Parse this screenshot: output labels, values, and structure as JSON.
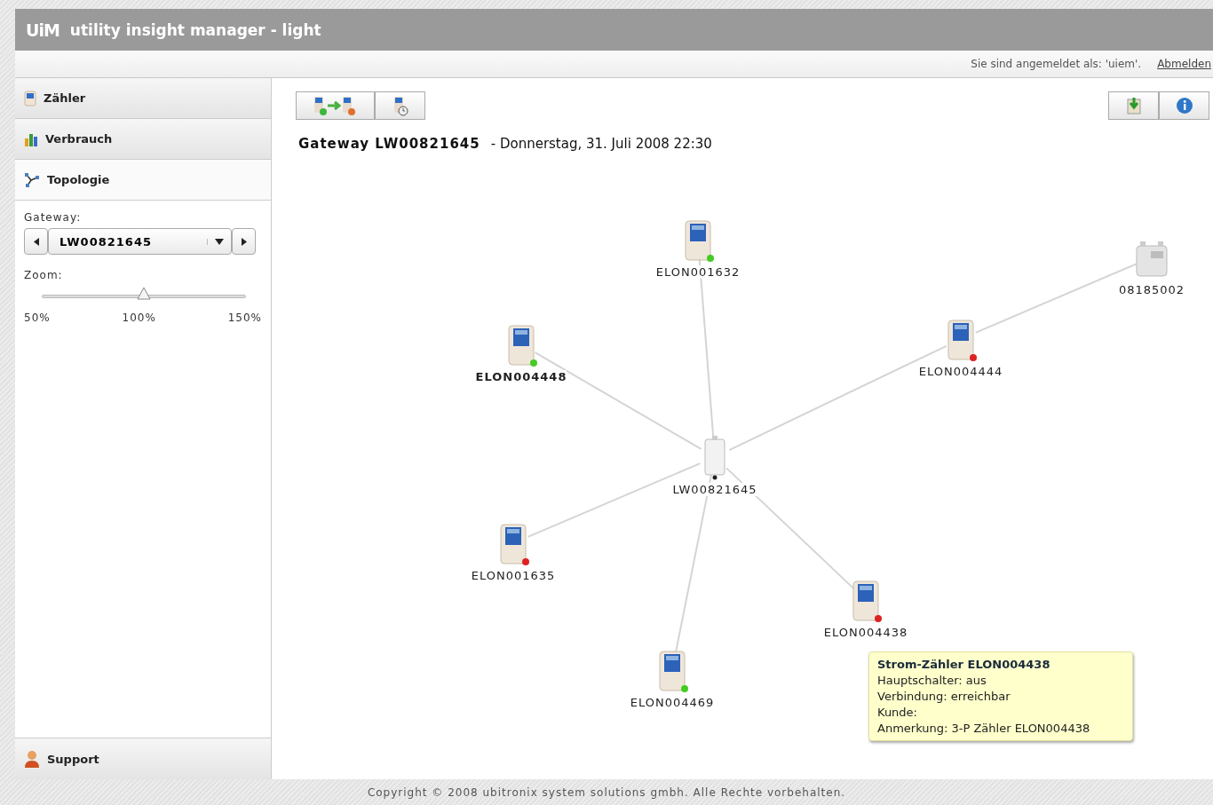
{
  "app": {
    "logo": "UiM",
    "title": "utility insight manager - light"
  },
  "user_bar": {
    "login_text": "Sie sind angemeldet als: 'uiem'.",
    "logout_link": "Abmelden"
  },
  "sidebar": {
    "items": [
      {
        "label": "Zähler",
        "kind": "meter",
        "selected": false
      },
      {
        "label": "Verbrauch",
        "kind": "consumption",
        "selected": false
      },
      {
        "label": "Topologie",
        "kind": "topology",
        "selected": true
      }
    ],
    "gateway_select": {
      "label": "Gateway:",
      "value": "LW00821645"
    },
    "zoom": {
      "label": "Zoom:",
      "level": 0.5,
      "ticks": [
        "50%",
        "100%",
        "150%"
      ]
    },
    "support": {
      "label": "Support"
    }
  },
  "heading": {
    "title": "Gateway LW00821645",
    "subtitle": "- Donnerstag, 31. Juli 2008 22:30"
  },
  "topology": {
    "nodes": [
      {
        "kind": "gateway",
        "label": "LW00821645",
        "selected": false
      },
      {
        "kind": "electric",
        "label": "ELON001632",
        "color": "#44cc22",
        "selected": false
      },
      {
        "kind": "electric",
        "label": "ELON004448",
        "color": "#44cc22",
        "selected": true
      },
      {
        "kind": "electric",
        "label": "ELON004444",
        "color": "#dd2222",
        "selected": false,
        "children": [
          {
            "kind": "gas",
            "label": "08185002",
            "selected": false
          }
        ]
      },
      {
        "kind": "electric",
        "label": "ELON001635",
        "color": "#dd2222",
        "selected": false
      },
      {
        "kind": "electric",
        "label": "ELON004438",
        "color": "#dd2222",
        "selected": false
      },
      {
        "kind": "electric",
        "label": "ELON004469",
        "color": "#44cc22",
        "selected": false
      }
    ]
  },
  "tooltip": {
    "title": "Strom-Zähler ELON004438",
    "lines": [
      "Hauptschalter: aus",
      "Verbindung: erreichbar",
      "Kunde:",
      "Anmerkung: 3-P Zähler ELON004438"
    ]
  },
  "footer": "Copyright © 2008 ubitronix system solutions gmbh. Alle Rechte vorbehalten."
}
